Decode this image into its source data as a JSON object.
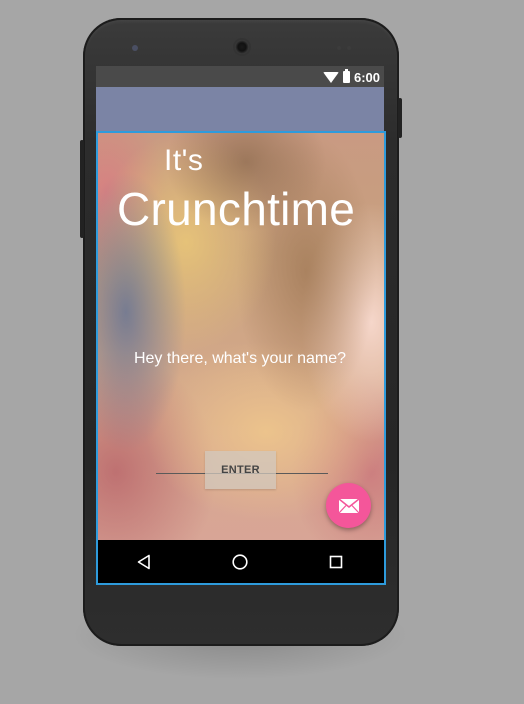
{
  "status_bar": {
    "time": "6:00",
    "icons": [
      "wifi-icon",
      "battery-icon"
    ]
  },
  "app": {
    "appbar_color": "#7b84a5",
    "greeting_small": "It's",
    "greeting_big": "Crunchtime",
    "prompt": "Hey there, what's your name?",
    "name_input": {
      "value": "",
      "placeholder": ""
    },
    "enter_button_label": "ENTER",
    "fab": {
      "icon": "mail-icon",
      "color": "#f4569a"
    }
  },
  "nav_bar": {
    "buttons": [
      "back-icon",
      "home-icon",
      "recents-icon"
    ]
  },
  "colors": {
    "selection_outline": "#2e9bdc",
    "status_bar": "#4a4a4a"
  }
}
